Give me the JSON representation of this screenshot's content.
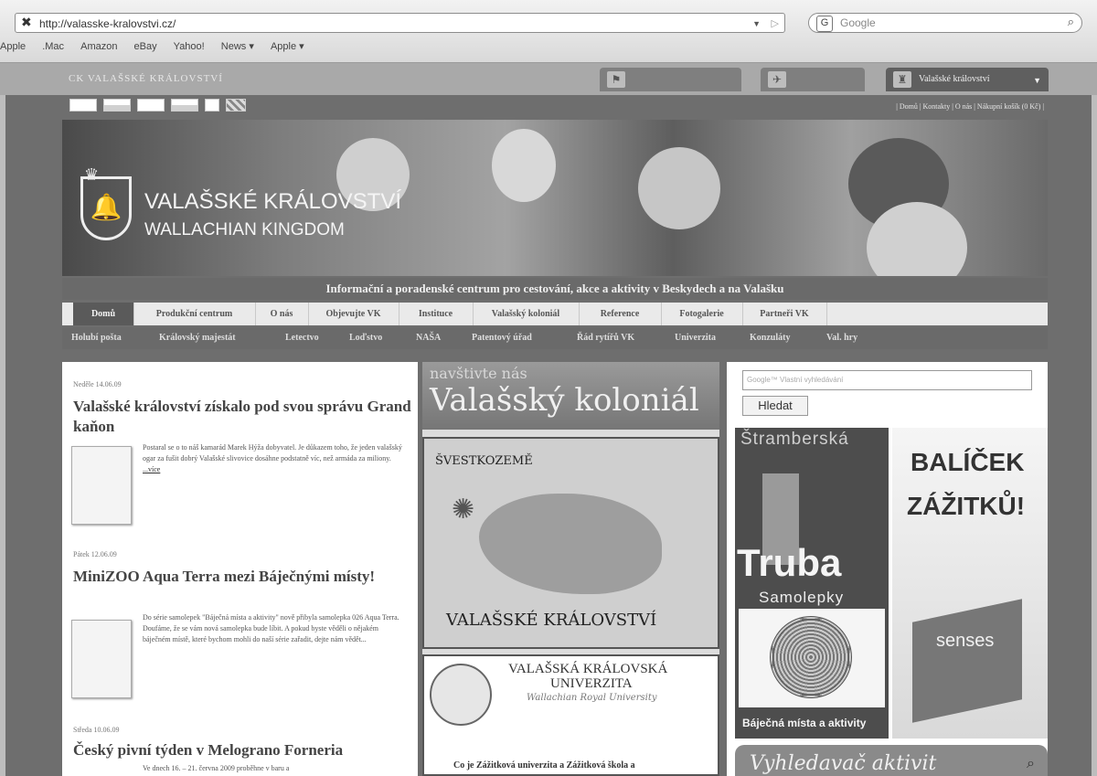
{
  "browser": {
    "url": "http://valasske-kralovstvi.cz/",
    "search_placeholder": "Google",
    "bookmarks": [
      "Apple",
      ".Mac",
      "Amazon",
      "eBay",
      "Yahoo!",
      "News ▾",
      "Apple ▾"
    ]
  },
  "site": {
    "brand": "CK VALAŠSKÉ KRÁLOVSTVÍ",
    "top_tabs": [
      "Valašské království"
    ],
    "top_links": "| Domů | Kontakty | O nás | Nákupní košík (0 Kč) |",
    "banner_title": "VALAŠSKÉ KRÁLOVSTVÍ",
    "banner_subtitle": "WALLACHIAN KINGDOM",
    "tagline": "Informační a poradenské centrum pro cestování, akce a aktivity v Beskydech a na Valašku",
    "main_nav": [
      "Domů",
      "Produkční centrum",
      "O nás",
      "Objevujte VK",
      "Instituce",
      "Valašský koloniál",
      "Reference",
      "Fotogalerie",
      "Partneři VK"
    ],
    "sub_nav": [
      "Holubí pošta",
      "Královský majestát",
      "Letectvo",
      "Loďstvo",
      "NAŠA",
      "Patentový úřad",
      "Řád rytířů VK",
      "Univerzita",
      "Konzuláty",
      "Val. hry"
    ]
  },
  "news": [
    {
      "date": "Neděle 14.06.09",
      "title": "Valašské království získalo pod svou správu Grand kaňon",
      "text": "Postaral se o to náš kamarád Marek Hýža dobyvatel. Je důkazem toho, že jeden valašský ogar za fušit dobrý Valašské slivovice dosáhne podstatně víc, než armáda za miliony.",
      "more": "...více"
    },
    {
      "date": "Pátek 12.06.09",
      "title": "MiniZOO Aqua Terra mezi Báječnými místy!",
      "text": "Do série samolepek \"Báječná místa a aktivity\" nově přibyla samolepka 026 Aqua Terra. Doufáme, že se vám nová samolepka bude líbit. A pokud byste věděli o nějakém báječném místě, které bychom mohli do naší série zařadit, dejte nám vědět...",
      "more": ""
    },
    {
      "date": "Středa 10.06.09",
      "title": "Český pivní týden v Melograno Forneria",
      "text": "Ve dnech 16. – 21. června 2009 proběhne v baru a",
      "more": ""
    }
  ],
  "middle": {
    "kolonial_top": "navštivte nás",
    "kolonial_title": "Valašský koloniál",
    "map_title": "ŠVESTKOZEMĚ",
    "map_footer": "VALAŠSKÉ KRÁLOVSTVÍ",
    "univ_line1": "VALAŠSKÁ KRÁLOVSKÁ",
    "univ_line2": "UNIVERZITA",
    "univ_line3": "Wallachian Royal University",
    "univ_question": "Co je Zážitková univerzita a Zážitková škola a"
  },
  "right": {
    "search_placeholder": "Google™ Vlastní vyhledávání",
    "search_button": "Hledat",
    "truba_top": "Štramberská",
    "truba_big": "Truba",
    "samolepky": "Samolepky",
    "bajecna": "Báječná místa a aktivity",
    "balicek1": "BALÍČEK",
    "balicek2": "ZÁŽITKŮ!",
    "senses": "senses",
    "vyhledavac": "Vyhledavač aktivit"
  },
  "icons": {
    "favicon": "x-logo-icon",
    "url_dropdown": "chevron-down-icon",
    "rss": "rss-icon",
    "google": "google-icon",
    "magnifier": "search-icon"
  }
}
